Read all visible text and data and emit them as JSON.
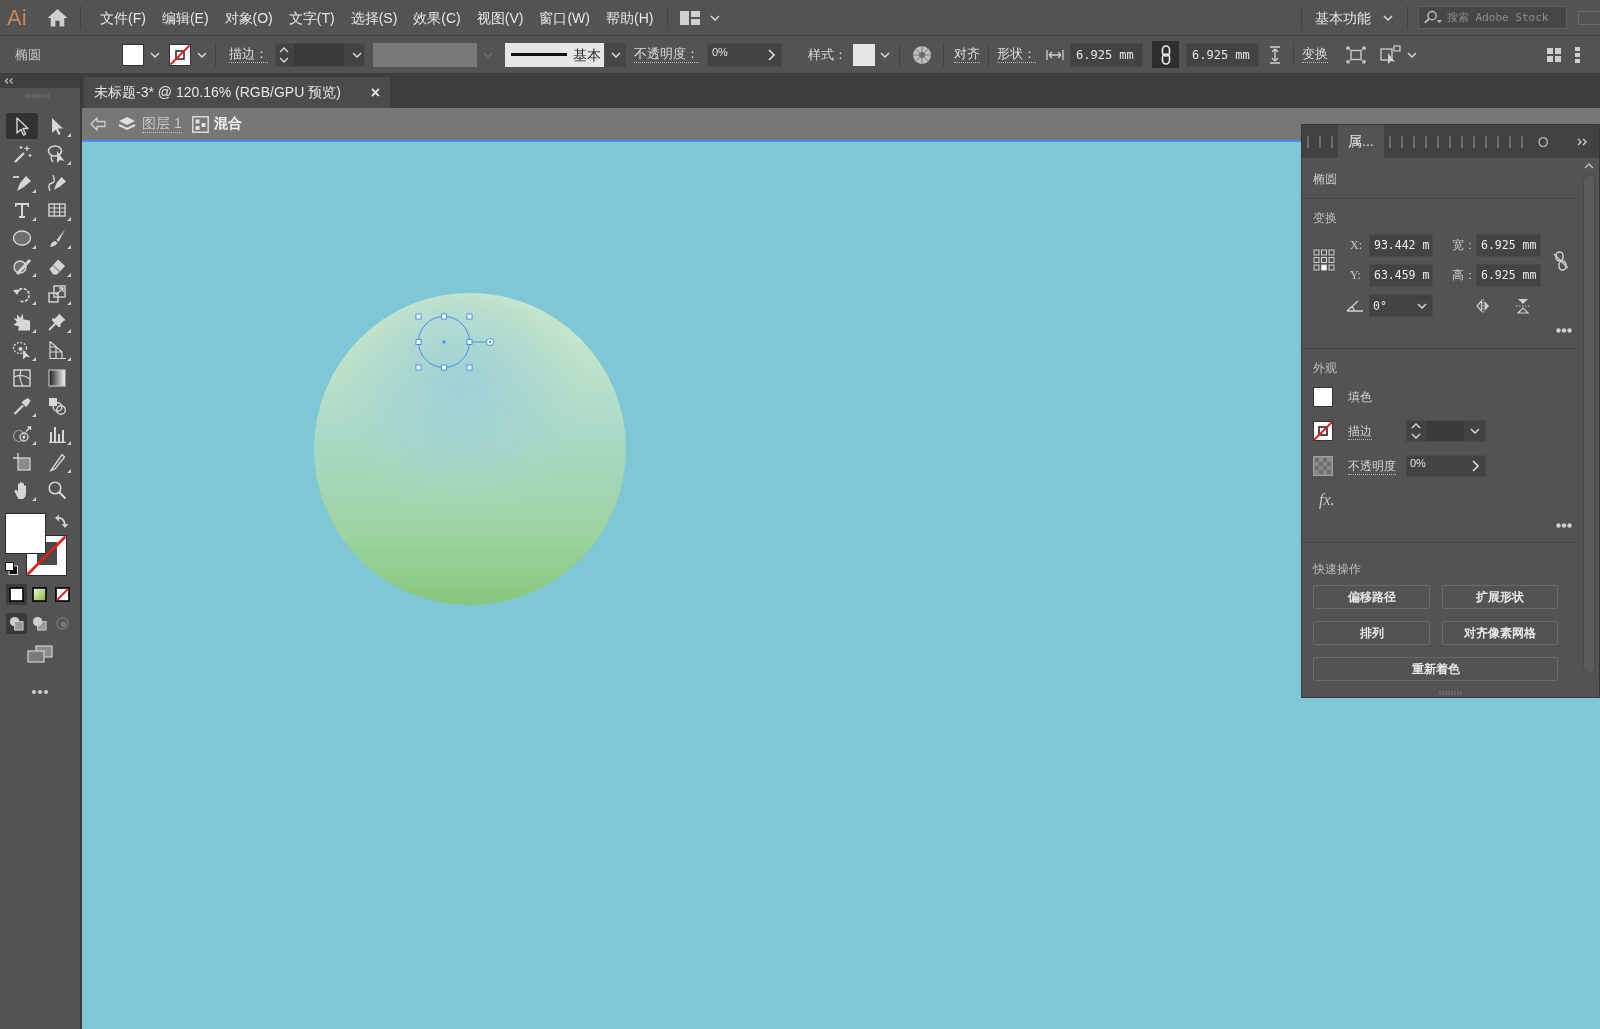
{
  "app": {
    "logo": "Ai"
  },
  "menu_bar": {
    "items": [
      "文件(F)",
      "编辑(E)",
      "对象(O)",
      "文字(T)",
      "选择(S)",
      "效果(C)",
      "视图(V)",
      "窗口(W)",
      "帮助(H)"
    ],
    "workspace": "基本功能",
    "search": {
      "placeholder": "搜索 Adobe Stock"
    }
  },
  "control_bar": {
    "object_type": "椭圆",
    "stroke_label": "描边：",
    "stroke_profile": "基本",
    "opacity_label": "不透明度：",
    "opacity": "0%",
    "style_label": "样式：",
    "align": "对齐",
    "shape_label": "形状：",
    "width": "6.925 mm",
    "height": "6.925 mm",
    "transform": "变换"
  },
  "tools": [
    {
      "kind": "selection",
      "selected": true,
      "flyout": false
    },
    {
      "kind": "direct-selection",
      "selected": false,
      "flyout": true
    },
    {
      "kind": "magic-wand",
      "selected": false,
      "flyout": false
    },
    {
      "kind": "lasso",
      "selected": false,
      "flyout": true
    },
    {
      "kind": "pen",
      "selected": false,
      "flyout": true
    },
    {
      "kind": "curvature",
      "selected": false,
      "flyout": false
    },
    {
      "kind": "type",
      "selected": false,
      "flyout": true
    },
    {
      "kind": "grid",
      "selected": false,
      "flyout": true
    },
    {
      "kind": "ellipse",
      "selected": false,
      "flyout": true
    },
    {
      "kind": "paintbrush",
      "selected": false,
      "flyout": true
    },
    {
      "kind": "shaper",
      "selected": false,
      "flyout": true
    },
    {
      "kind": "eraser",
      "selected": false,
      "flyout": true
    },
    {
      "kind": "rotate",
      "selected": false,
      "flyout": true
    },
    {
      "kind": "scale",
      "selected": false,
      "flyout": true
    },
    {
      "kind": "puppet-warp",
      "selected": false,
      "flyout": true
    },
    {
      "kind": "pin",
      "selected": false,
      "flyout": true
    },
    {
      "kind": "free-transform",
      "selected": false,
      "flyout": true
    },
    {
      "kind": "perspective-grid",
      "selected": false,
      "flyout": true
    },
    {
      "kind": "mesh",
      "selected": false,
      "flyout": false
    },
    {
      "kind": "gradient",
      "selected": false,
      "flyout": false
    },
    {
      "kind": "eyedropper",
      "selected": false,
      "flyout": true
    },
    {
      "kind": "blend",
      "selected": false,
      "flyout": false
    },
    {
      "kind": "symbol-sprayer",
      "selected": false,
      "flyout": true
    },
    {
      "kind": "graph",
      "selected": false,
      "flyout": true
    },
    {
      "kind": "artboard",
      "selected": false,
      "flyout": false
    },
    {
      "kind": "slice",
      "selected": false,
      "flyout": true
    },
    {
      "kind": "hand",
      "selected": false,
      "flyout": true
    },
    {
      "kind": "zoom",
      "selected": false,
      "flyout": false
    }
  ],
  "color_modes": [
    {
      "kind": "color",
      "selected": true
    },
    {
      "kind": "gradient",
      "selected": false
    },
    {
      "kind": "none",
      "selected": false
    }
  ],
  "draw_modes": [
    {
      "kind": "normal",
      "selected": true
    },
    {
      "kind": "behind",
      "selected": false
    },
    {
      "kind": "inside",
      "selected": false
    }
  ],
  "document_tab": {
    "title": "未标题-3* @ 120.16% (RGB/GPU 预览)",
    "close": "×"
  },
  "breadcrumb": {
    "layer": "图层 1",
    "group": "混合"
  },
  "properties_panel": {
    "tabs": [
      {
        "label": "属...",
        "selected": true
      },
      {
        "label": "O",
        "selected": false
      }
    ],
    "object_type": "椭圆",
    "transform": {
      "title": "变换",
      "x_label": "X:",
      "x": "93.442 m",
      "y_label": "Y:",
      "y": "63.459 m",
      "width_label": "宽：",
      "width": "6.925 mm",
      "height_label": "高：",
      "height": "6.925 mm",
      "angle": "0°"
    },
    "appearance": {
      "title": "外观",
      "fill": "填色",
      "stroke": "描边",
      "opacity_label": "不透明度",
      "opacity": "0%",
      "effects": "fx."
    },
    "quick_actions": {
      "title": "快速操作",
      "buttons": [
        "偏移路径",
        "扩展形状",
        "排列",
        "对齐像素网格",
        "重新着色"
      ]
    }
  }
}
